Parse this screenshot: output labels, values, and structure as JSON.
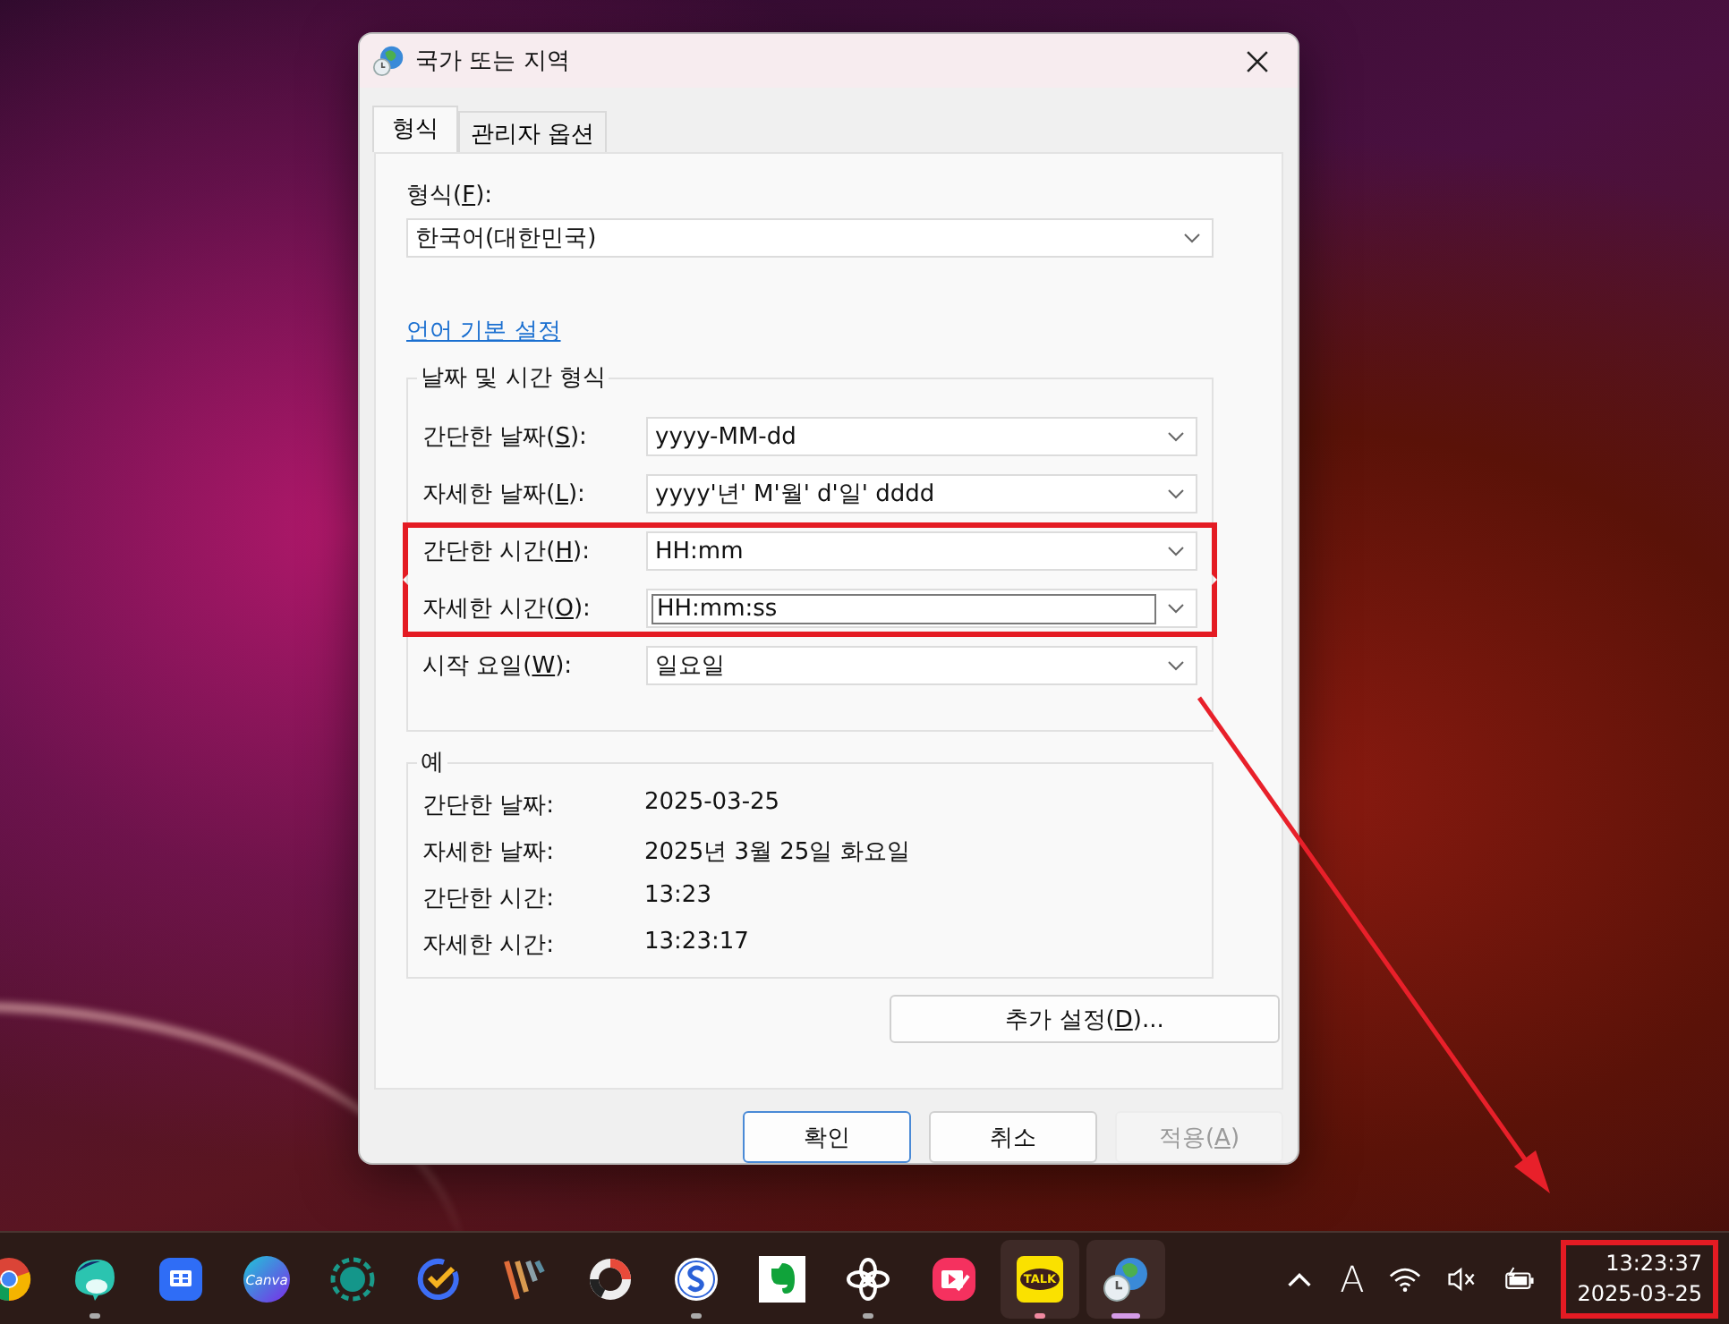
{
  "window": {
    "title": "국가 또는 지역"
  },
  "tabs": [
    {
      "label": "형식",
      "selected": true
    },
    {
      "label": "관리자 옵션",
      "selected": false
    }
  ],
  "format": {
    "label": {
      "pre": "형식(",
      "key": "F",
      "post": "):"
    },
    "value": "한국어(대한민국)"
  },
  "language_link": "언어 기본 설정",
  "date_time_formats": {
    "title": "날짜 및 시간 형식",
    "rows": [
      {
        "label": {
          "pre": "간단한 날짜(",
          "key": "S",
          "post": "):"
        },
        "value": "yyyy-MM-dd",
        "editing": false,
        "highlighted": false
      },
      {
        "label": {
          "pre": "자세한 날짜(",
          "key": "L",
          "post": "):"
        },
        "value": "yyyy'년' M'월' d'일' dddd",
        "editing": false,
        "highlighted": false
      },
      {
        "label": {
          "pre": "간단한 시간(",
          "key": "H",
          "post": "):"
        },
        "value": "HH:mm",
        "editing": false,
        "highlighted": true
      },
      {
        "label": {
          "pre": "자세한 시간(",
          "key": "O",
          "post": "):"
        },
        "value": "HH:mm:ss",
        "editing": true,
        "highlighted": true
      },
      {
        "label": {
          "pre": "시작 요일(",
          "key": "W",
          "post": "):"
        },
        "value": "일요일",
        "editing": false,
        "highlighted": false
      }
    ]
  },
  "examples": {
    "title": "예",
    "rows": [
      {
        "label": "간단한 날짜:",
        "value": "2025-03-25"
      },
      {
        "label": "자세한 날짜:",
        "value": "2025년 3월 25일 화요일"
      },
      {
        "label": "간단한 시간:",
        "value": "13:23"
      },
      {
        "label": "자세한 시간:",
        "value": "13:23:17"
      }
    ]
  },
  "more_settings_button": {
    "pre": "추가 설정(",
    "key": "D",
    "post": ")..."
  },
  "buttons": [
    {
      "pre": "확인",
      "default": true,
      "disabled": false
    },
    {
      "pre": "취소",
      "default": false,
      "disabled": false
    },
    {
      "pre": "적용(",
      "key": "A",
      "post": ")",
      "default": false,
      "disabled": true
    }
  ],
  "annotation_arrow": true,
  "taskbar": {
    "apps": [
      {
        "kind": "chrome",
        "running": false,
        "focused": false
      },
      {
        "kind": "whale",
        "running": true,
        "focused": false
      },
      {
        "kind": "remote",
        "running": false,
        "focused": false
      },
      {
        "kind": "canva",
        "logo_text": "Canva",
        "running": false,
        "focused": false
      },
      {
        "kind": "ring",
        "running": false,
        "focused": false
      },
      {
        "kind": "check",
        "running": false,
        "focused": false
      },
      {
        "kind": "stripes",
        "running": false,
        "focused": false
      },
      {
        "kind": "donut",
        "running": false,
        "focused": false
      },
      {
        "kind": "s-circle",
        "running": true,
        "focused": false
      },
      {
        "kind": "elephant",
        "running": false,
        "focused": false
      },
      {
        "kind": "knot",
        "running": true,
        "focused": false
      },
      {
        "kind": "video",
        "running": false,
        "focused": false
      },
      {
        "kind": "chat",
        "logo_text": "TALK",
        "running": true,
        "focused": false
      },
      {
        "kind": "globe",
        "running": true,
        "focused": true
      }
    ],
    "input_indicator": "A",
    "clock": {
      "time": "13:23:37",
      "date": "2025-03-25",
      "highlighted": true
    }
  }
}
